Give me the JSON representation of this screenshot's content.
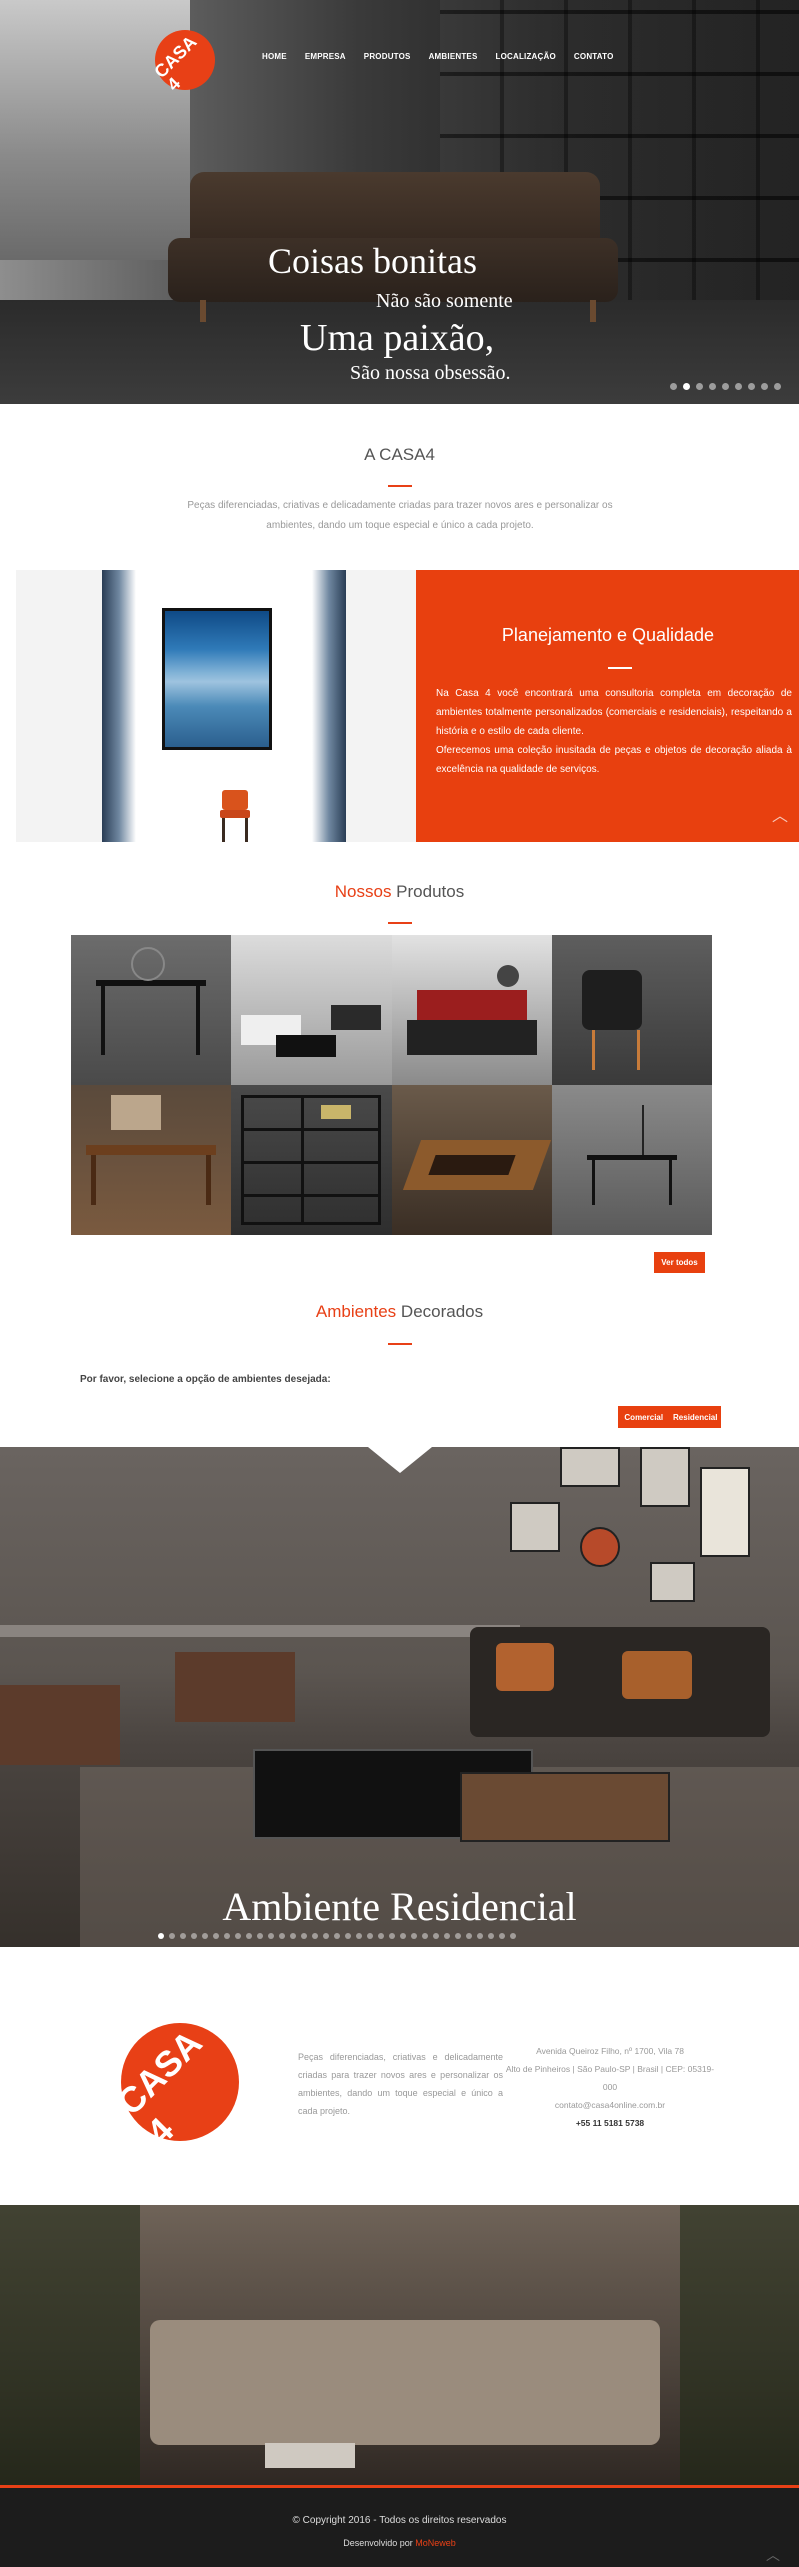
{
  "brand": {
    "logo_text": "CASA 4",
    "accent_color": "#e84016"
  },
  "nav": {
    "items": [
      "HOME",
      "EMPRESA",
      "PRODUTOS",
      "AMBIENTES",
      "LOCALIZAÇÃO",
      "CONTATO"
    ]
  },
  "hero": {
    "line1": "Coisas bonitas",
    "line2": "Não são somente",
    "line3": "Uma paixão,",
    "line4": "São nossa obsessão.",
    "slide_count": 9,
    "active_slide": 2
  },
  "about": {
    "title": "A CASA4",
    "text": "Peças diferenciadas, criativas e delicadamente criadas para trazer novos ares e personalizar os ambientes, dando um toque especial e único a cada projeto."
  },
  "planning": {
    "title": "Planejamento e Qualidade",
    "p1": "Na Casa 4 você encontrará uma consultoria completa em decoração de ambientes totalmente personalizados (comerciais e residenciais), respeitando a história e o estilo de cada cliente.",
    "p2": "Oferecemos uma coleção inusitada de peças e objetos de decoração aliada à excelência na qualidade de serviços."
  },
  "products": {
    "title_highlight": "Nossos",
    "title_rest": " Produtos",
    "view_all": "Ver todos",
    "tiles": [
      "console-table",
      "living-room",
      "bedroom",
      "armchair",
      "desk",
      "bookshelf",
      "coffee-table",
      "side-table"
    ]
  },
  "environments": {
    "title_highlight": "Ambientes",
    "title_rest": " Decorados",
    "prompt": "Por favor, selecione a opção de ambientes desejada:",
    "btn_commercial": "Comercial",
    "btn_residential": "Residencial",
    "slide_title": "Ambiente Residencial",
    "slide_count": 33,
    "active_slide": 1
  },
  "footer": {
    "logo_text": "CASA 4",
    "description": "Peças diferenciadas, criativas e delicadamente criadas para trazer novos ares e personalizar os ambientes, dando um toque especial e único a cada projeto.",
    "address1": "Avenida Queiroz Filho, nº 1700, Vila 78",
    "address2": "Alto de Pinheiros | São Paulo-SP | Brasil | CEP: 05319-000",
    "email": "contato@casa4online.com.br",
    "phone": "+55 11 5181 5738"
  },
  "copyright": {
    "text": "© Copyright 2016 - Todos os direitos reservados",
    "dev_prefix": "Desenvolvido por ",
    "dev_name": "MoNeweb"
  }
}
